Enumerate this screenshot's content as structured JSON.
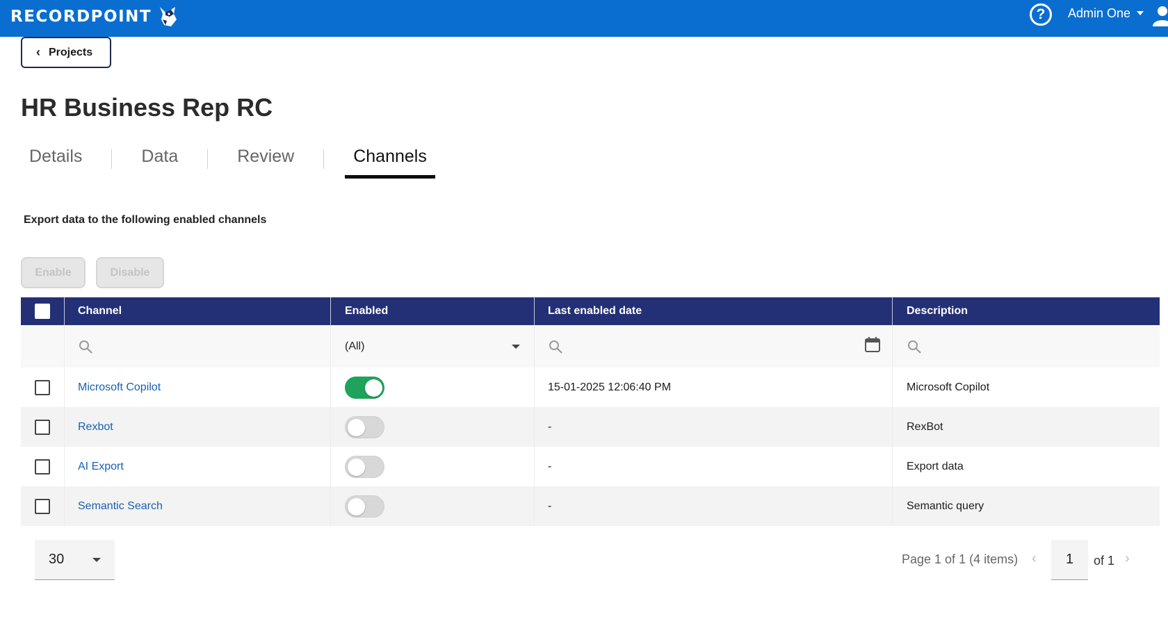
{
  "header": {
    "logo_text": "RECORDPOINT",
    "help_symbol": "?",
    "user_name": "Admin One"
  },
  "nav": {
    "back_label": "Projects"
  },
  "page": {
    "title": "HR Business Rep RC"
  },
  "tabs": [
    {
      "label": "Details",
      "active": false
    },
    {
      "label": "Data",
      "active": false
    },
    {
      "label": "Review",
      "active": false
    },
    {
      "label": "Channels",
      "active": true
    }
  ],
  "channels": {
    "subheading": "Export data to the following enabled channels",
    "enable_label": "Enable",
    "disable_label": "Disable",
    "columns": {
      "channel": "Channel",
      "enabled": "Enabled",
      "last_enabled_date": "Last enabled date",
      "description": "Description"
    },
    "filter": {
      "enabled_value": "(All)"
    },
    "rows": [
      {
        "channel": "Microsoft Copilot",
        "enabled": true,
        "last_enabled_date": "15-01-2025 12:06:40 PM",
        "description": "Microsoft Copilot"
      },
      {
        "channel": "Rexbot",
        "enabled": false,
        "last_enabled_date": "-",
        "description": "RexBot"
      },
      {
        "channel": "AI Export",
        "enabled": false,
        "last_enabled_date": "-",
        "description": "Export data"
      },
      {
        "channel": "Semantic Search",
        "enabled": false,
        "last_enabled_date": "-",
        "description": "Semantic query"
      }
    ]
  },
  "pager": {
    "page_size": "30",
    "info": "Page 1 of 1 (4 items)",
    "current_page": "1",
    "of_label": "of 1"
  },
  "colors": {
    "topbar": "#0a6ed1",
    "grid_header": "#243075",
    "toggle_on": "#1fa35c",
    "link": "#1a5fb4"
  },
  "icons": {
    "help": "help-circle-icon",
    "user": "user-icon",
    "back": "chevron-left-icon",
    "search": "search-icon",
    "calendar": "calendar-icon",
    "dropdown": "caret-down-icon",
    "prev": "chevron-left-icon",
    "next": "chevron-right-icon"
  }
}
